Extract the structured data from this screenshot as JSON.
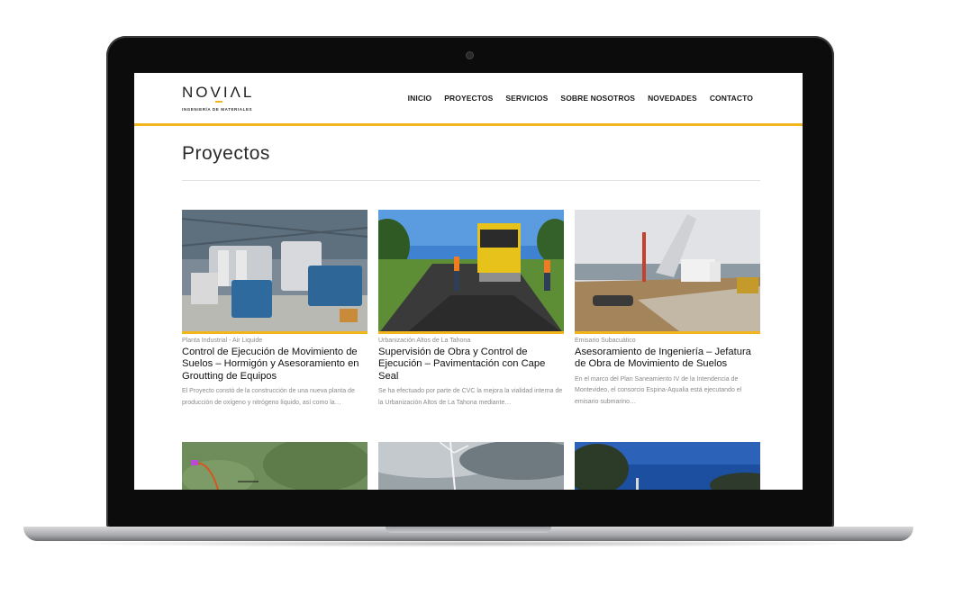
{
  "site": {
    "logo_text": "NOVIΛL",
    "logo_subtitle": "INGENIERÍA DE MATERIALES",
    "nav": [
      "INICIO",
      "PROYECTOS",
      "SERVICIOS",
      "SOBRE NOSOTROS",
      "NOVEDADES",
      "CONTACTO"
    ],
    "accent": "#f2b51c"
  },
  "page": {
    "title": "Proyectos"
  },
  "projects": [
    {
      "category": "Planta Industrial - Air Liquide",
      "title": "Control de Ejecución de Movimiento de Suelos – Hormigón y Asesoramiento en Groutting de Equipos",
      "excerpt": "El Proyecto constó de la construcción de una nueva planta de producción de oxígeno y nitrógeno líquido, así como la…",
      "image": "industrial-plant-photo"
    },
    {
      "category": "Urbanización Altos de La Tahona",
      "title": "Supervisión de Obra y Control de Ejecución – Pavimentación con Cape Seal",
      "excerpt": "Se ha efectuado por parte de CVC la mejora la vialidad interna de la Urbanización Altos de La Tahona mediante…",
      "image": "road-paving-photo"
    },
    {
      "category": "Emisario Subacuático",
      "title": "Asesoramiento de Ingeniería – Jefatura de Obra de Movimiento de Suelos",
      "excerpt": "En el marco del Plan Saneamiento IV de la Intendencia de Montevideo, el consorcio Espina-Aqualia está ejecutando el emisario submarino…",
      "image": "dump-truck-coast-photo"
    }
  ],
  "more_projects": [
    {
      "image": "aerial-map-photo"
    },
    {
      "image": "wind-turbine-photo"
    },
    {
      "image": "trees-blue-sky-photo"
    }
  ]
}
